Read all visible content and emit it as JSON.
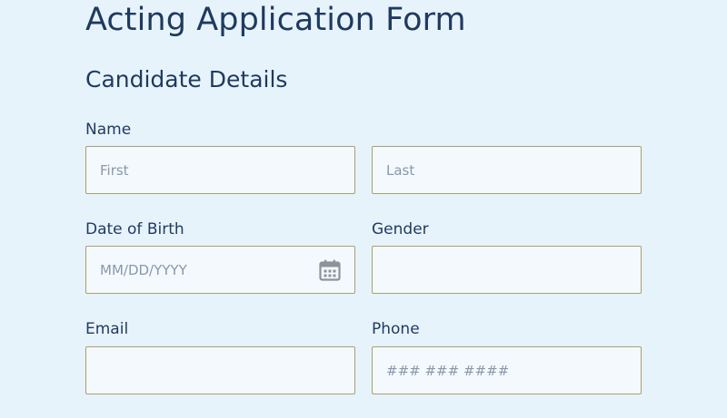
{
  "form": {
    "title": "Acting Application Form",
    "section_title": "Candidate Details",
    "name": {
      "label": "Name",
      "first_placeholder": "First",
      "last_placeholder": "Last",
      "first_value": "",
      "last_value": ""
    },
    "date_of_birth": {
      "label": "Date of Birth",
      "placeholder": "MM/DD/YYYY",
      "value": "",
      "icon": "calendar-icon"
    },
    "gender": {
      "label": "Gender",
      "placeholder": "",
      "value": ""
    },
    "email": {
      "label": "Email",
      "placeholder": "",
      "value": ""
    },
    "phone": {
      "label": "Phone",
      "placeholder": "### ### ####",
      "value": ""
    }
  },
  "colors": {
    "background": "#e7f3fb",
    "text": "#1f3a5f",
    "field_border": "#a8a070",
    "field_background": "#f3f9fd",
    "placeholder": "#8a98a8",
    "icon": "#8c939a"
  }
}
